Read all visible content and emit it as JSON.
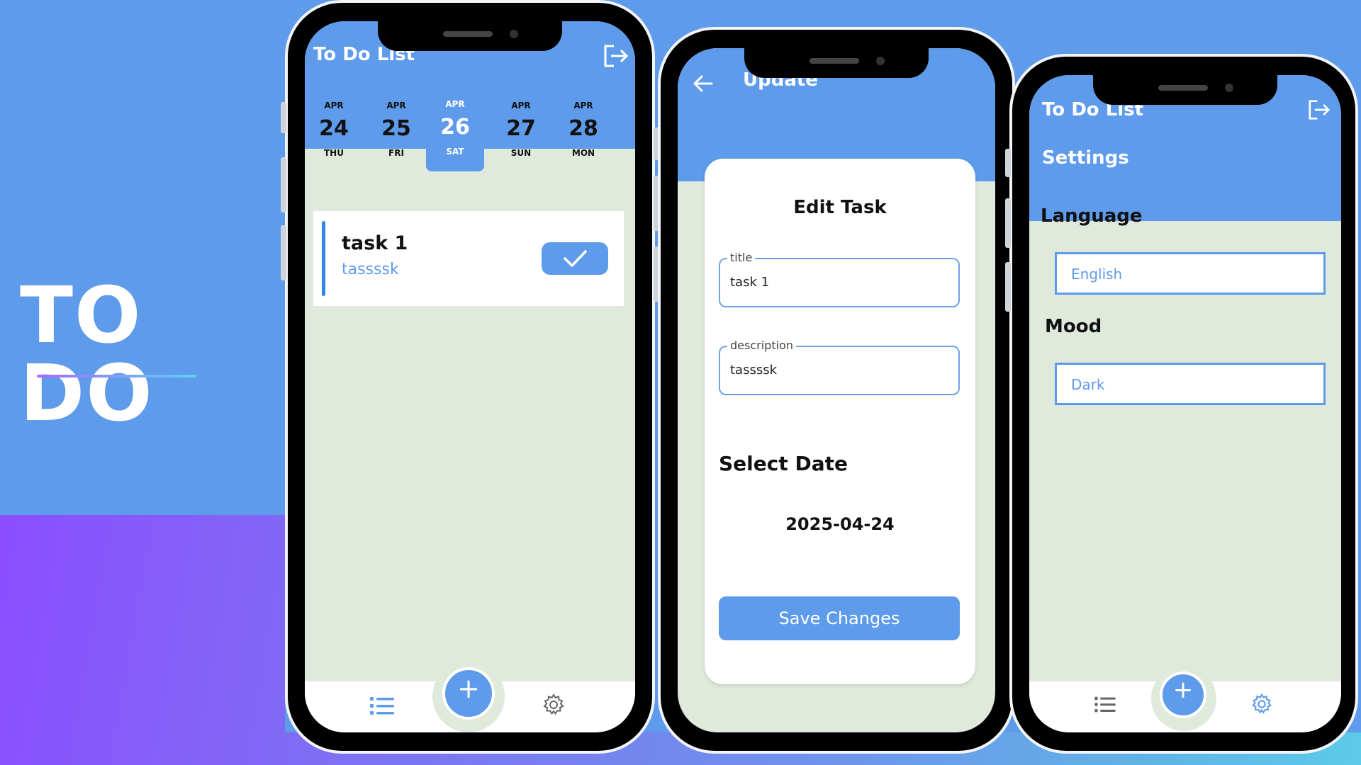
{
  "hero": {
    "title": "TO DO"
  },
  "phone1": {
    "app_title": "To Do List",
    "dates": [
      {
        "month": "APR",
        "day": "24",
        "weekday": "THU",
        "selected": false
      },
      {
        "month": "APR",
        "day": "25",
        "weekday": "FRI",
        "selected": false
      },
      {
        "month": "APR",
        "day": "26",
        "weekday": "SAT",
        "selected": true
      },
      {
        "month": "APR",
        "day": "27",
        "weekday": "SUN",
        "selected": false
      },
      {
        "month": "APR",
        "day": "28",
        "weekday": "MON",
        "selected": false
      }
    ],
    "task": {
      "title": "task 1",
      "description": "tassssk"
    }
  },
  "phone2": {
    "header_title": "Update",
    "card_title": "Edit Task",
    "title_field": {
      "label": "title",
      "value": "task 1"
    },
    "description_field": {
      "label": "description",
      "value": "tassssk"
    },
    "select_date_label": "Select Date",
    "date_value": "2025-04-24",
    "save_label": "Save Changes"
  },
  "phone3": {
    "app_title": "To Do List",
    "settings_title": "Settings",
    "language_label": "Language",
    "language_value": "English",
    "mood_label": "Mood",
    "mood_value": "Dark"
  },
  "colors": {
    "primary": "#5e9bea",
    "screen_bg": "#dfe9dc",
    "task_bar": "#2f86e6"
  },
  "icons": [
    "logout-icon",
    "back-arrow-icon",
    "checkmark-icon",
    "plus-icon",
    "list-icon",
    "gear-icon"
  ]
}
